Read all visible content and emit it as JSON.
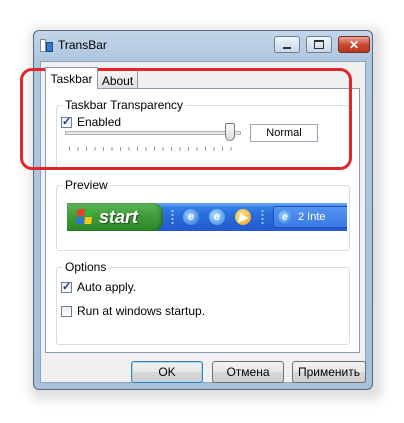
{
  "window": {
    "title": "TransBar",
    "controls": {
      "minimize": "minimize",
      "maximize": "maximize",
      "close": "✕"
    }
  },
  "tabs": [
    {
      "label": "Taskbar",
      "active": true
    },
    {
      "label": "About",
      "active": false
    }
  ],
  "transparency": {
    "group_label": "Taskbar Transparency",
    "enabled_label": "Enabled",
    "enabled_checked": true,
    "slider_level": 0.95,
    "level_text": "Normal"
  },
  "preview": {
    "group_label": "Preview",
    "start_label": "start",
    "task_label": "2 Inte"
  },
  "options": {
    "group_label": "Options",
    "auto_apply_label": "Auto apply.",
    "auto_apply_checked": true,
    "startup_label": "Run at windows startup.",
    "startup_checked": false
  },
  "buttons": {
    "ok": "OK",
    "cancel": "Отмена",
    "apply": "Применить"
  },
  "colors": {
    "highlight": "#e0262b",
    "xp_start_green": "#3d9a37",
    "xp_taskbar_blue": "#2a6bd9"
  }
}
